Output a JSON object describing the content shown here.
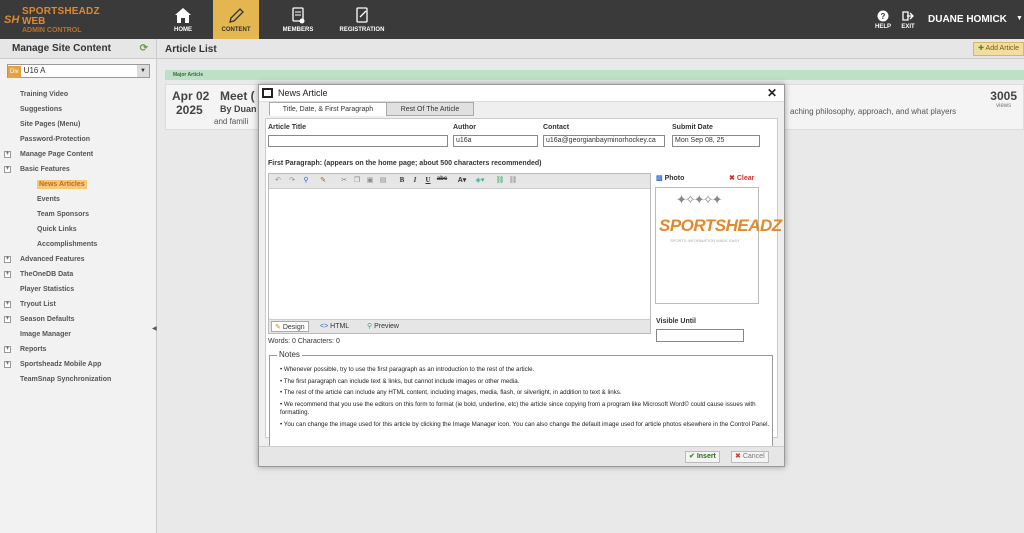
{
  "header": {
    "logo_line1": "SPORTSHEADZ",
    "logo_line2": "WEB",
    "logo_line3": "ADMIN CONTROL",
    "logo_mark": "SH",
    "nav": [
      {
        "label": "HOME",
        "icon": "home-icon"
      },
      {
        "label": "CONTENT",
        "icon": "pencil-icon",
        "active": true
      },
      {
        "label": "MEMBERS",
        "icon": "members-icon"
      },
      {
        "label": "REGISTRATION",
        "icon": "registration-icon"
      }
    ],
    "help_label": "HELP",
    "exit_label": "EXIT",
    "user_name": "DUANE HOMICK",
    "user_caret": "▼",
    "accent_color": "#e3b64f",
    "bar_color": "#3a3a3a"
  },
  "sidebar": {
    "title": "Manage Site Content",
    "refresh_icon": "refresh-icon",
    "team_label": "Div",
    "team_value": "U16 A",
    "items": [
      {
        "label": "Training Video",
        "level": 0,
        "expander": false
      },
      {
        "label": "Suggestions",
        "level": 0,
        "expander": false
      },
      {
        "label": "Site Pages (Menu)",
        "level": 0,
        "expander": false
      },
      {
        "label": "Password-Protection",
        "level": 0,
        "expander": false
      },
      {
        "label": "Manage Page Content",
        "level": 0,
        "expander": true
      },
      {
        "label": "Basic Features",
        "level": 0,
        "expander": true
      },
      {
        "label": "News Articles",
        "level": 1,
        "expander": false,
        "selected": true
      },
      {
        "label": "Events",
        "level": 1,
        "expander": false
      },
      {
        "label": "Team Sponsors",
        "level": 1,
        "expander": false
      },
      {
        "label": "Quick Links",
        "level": 1,
        "expander": false
      },
      {
        "label": "Accomplishments",
        "level": 1,
        "expander": false
      },
      {
        "label": "Advanced Features",
        "level": 0,
        "expander": true
      },
      {
        "label": "TheOneDB Data",
        "level": 0,
        "expander": true
      },
      {
        "label": "Player Statistics",
        "level": 0,
        "expander": false
      },
      {
        "label": "Tryout List",
        "level": 0,
        "expander": true
      },
      {
        "label": "Season Defaults",
        "level": 0,
        "expander": true
      },
      {
        "label": "Image Manager",
        "level": 0,
        "expander": false
      },
      {
        "label": "Reports",
        "level": 0,
        "expander": true
      },
      {
        "label": "Sportsheadz Mobile App",
        "level": 0,
        "expander": true
      },
      {
        "label": "TeamSnap Synchronization",
        "level": 0,
        "expander": false
      }
    ],
    "collapse_handle": "◀"
  },
  "main": {
    "title": "Article List",
    "add_button": "Add Article",
    "major_label": "Major Article",
    "article": {
      "date_month_day": "Apr 02",
      "date_year": "2025",
      "title_fragment": "Meet (",
      "byline_fragment": "By Duan",
      "body_fragment": "and famili",
      "excerpt_fragment": "aching philosophy, approach, and what players",
      "views_count": "3005",
      "views_label": "views"
    }
  },
  "modal": {
    "title": "News Article",
    "close": "✕",
    "tabs": [
      "Title, Date, & First Paragraph",
      "Rest Of The Article"
    ],
    "fields": {
      "title_label": "Article Title",
      "title_value": "",
      "author_label": "Author",
      "author_value": "u16a",
      "contact_label": "Contact",
      "contact_value": "u16a@georgianbayminorhockey.ca",
      "date_label": "Submit Date",
      "date_value": "Mon Sep 08, 25"
    },
    "first_paragraph_label": "First Paragraph: (appears on the home page; about 500 characters recommended)",
    "editor_modes": [
      "Design",
      "HTML",
      "Preview"
    ],
    "word_count": "Words: 0  Characters: 0",
    "photo_label": "Photo",
    "clear_label": "Clear",
    "photo_logo_text": "SPORTSHEADZ",
    "photo_logo_sub": "SPORTS INFORMATION MADE EASY",
    "visible_until_label": "Visible Until",
    "visible_until_value": "",
    "notes_title": "Notes",
    "notes": [
      "• Whenever possible, try to use the first paragraph as an introduction to the rest of the article.",
      "• The first paragraph can include text & links, but cannot include images or other media.",
      "• The rest of the article can include any HTML content, including images, media, flash, or silverlight, in addition to text & links.",
      "• We recommend that you use the editors on this form to format (ie bold, underline, etc) the article since copying from a program like Microsoft Word© could cause issues with formatting.",
      "• You can change the image used for this article by clicking the Image Manager icon. You can also change the default image used for article photos elsewhere in the Control Panel."
    ],
    "insert_label": "Insert",
    "cancel_label": "Cancel"
  }
}
